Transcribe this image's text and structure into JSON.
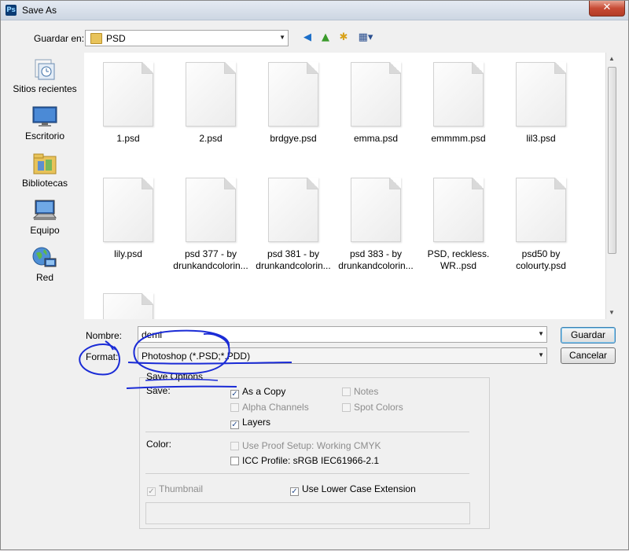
{
  "window": {
    "title": "Save As",
    "app_icon_text": "Ps",
    "close_label": "✕"
  },
  "location": {
    "label": "Guardar en:",
    "value": "PSD"
  },
  "toolbar": {
    "back": "◀",
    "up": "▲",
    "new_folder": "✱",
    "views": "▦▾"
  },
  "sidebar": {
    "items": [
      {
        "label": "Sitios recientes",
        "icon": "recent-places-icon"
      },
      {
        "label": "Escritorio",
        "icon": "desktop-icon"
      },
      {
        "label": "Bibliotecas",
        "icon": "libraries-icon"
      },
      {
        "label": "Equipo",
        "icon": "computer-icon"
      },
      {
        "label": "Red",
        "icon": "network-icon"
      }
    ]
  },
  "files": [
    {
      "line1": "1.psd",
      "line2": ""
    },
    {
      "line1": "2.psd",
      "line2": ""
    },
    {
      "line1": "brdgye.psd",
      "line2": ""
    },
    {
      "line1": "emma.psd",
      "line2": ""
    },
    {
      "line1": "emmmm.psd",
      "line2": ""
    },
    {
      "line1": "lil3.psd",
      "line2": ""
    },
    {
      "line1": "lily.psd",
      "line2": ""
    },
    {
      "line1": "psd 377 - by",
      "line2": "drunkandcolorin..."
    },
    {
      "line1": "psd 381 - by",
      "line2": "drunkandcolorin..."
    },
    {
      "line1": "psd 383 - by",
      "line2": "drunkandcolorin..."
    },
    {
      "line1": "PSD, reckless.",
      "line2": "WR..psd"
    },
    {
      "line1": "psd50 by",
      "line2": "colourty.psd"
    }
  ],
  "name_field": {
    "label": "Nombre:",
    "value": "demi"
  },
  "format_field": {
    "label": "Format:",
    "value": "Photoshop (*.PSD;*.PDD)"
  },
  "buttons": {
    "save": "Guardar",
    "cancel": "Cancelar"
  },
  "save_options": {
    "group_label": "Save Options",
    "save_label": "Save:",
    "as_copy": {
      "label": "As a Copy",
      "checked": true,
      "enabled": true
    },
    "notes": {
      "label": "Notes",
      "checked": false,
      "enabled": false
    },
    "alpha_channels": {
      "label": "Alpha Channels",
      "checked": false,
      "enabled": false
    },
    "spot_colors": {
      "label": "Spot Colors",
      "checked": false,
      "enabled": false
    },
    "layers": {
      "label": "Layers",
      "checked": true,
      "enabled": true
    },
    "color_label": "Color:",
    "proof_setup": {
      "label": "Use Proof Setup:  Working CMYK",
      "checked": false,
      "enabled": false
    },
    "icc_profile": {
      "label": "ICC Profile:  sRGB IEC61966-2.1",
      "checked": false,
      "enabled": true
    },
    "thumbnail": {
      "label": "Thumbnail",
      "checked": true,
      "enabled": false
    },
    "lower_case": {
      "label": "Use Lower Case Extension",
      "checked": true,
      "enabled": true
    }
  },
  "colors": {
    "annotation_ink": "#1a2bd6",
    "default_button_border": "#3c7fb1"
  }
}
